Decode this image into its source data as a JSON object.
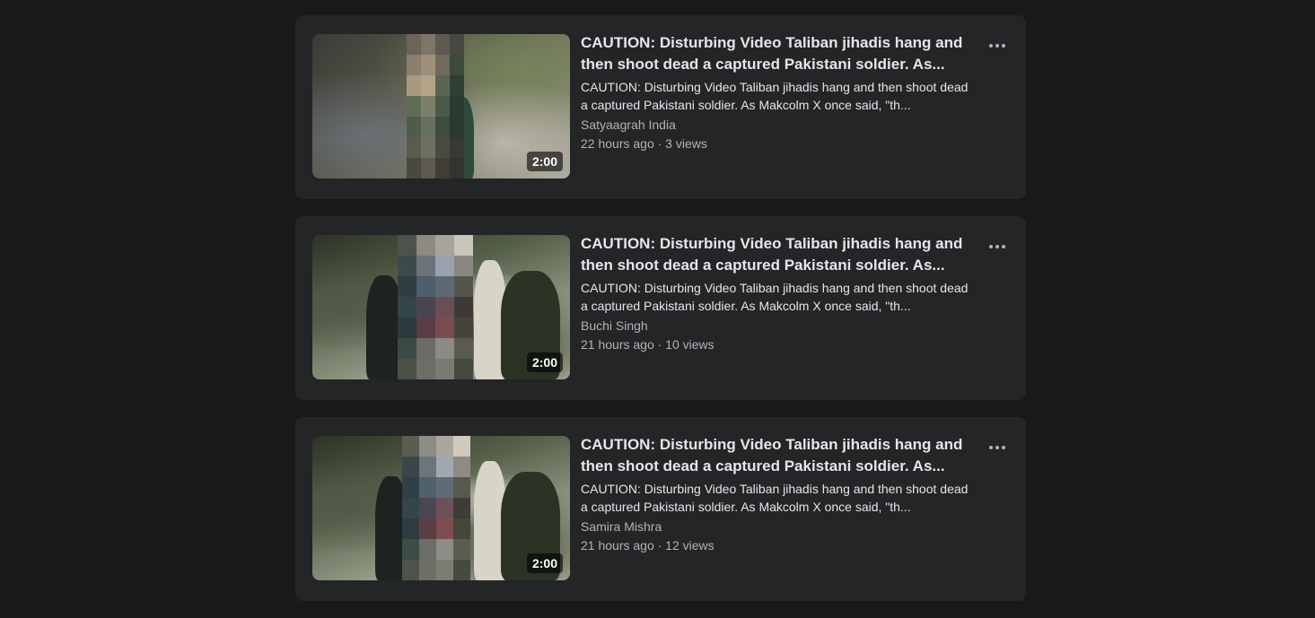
{
  "videos": [
    {
      "title": "CAUTION: Disturbing Video Taliban jihadis hang and then shoot dead a captured Pakistani soldier. As...",
      "description": "CAUTION: Disturbing Video Taliban jihadis hang and then shoot dead a captured Pakistani soldier. As Makcolm X once said, \"th...",
      "author": "Satyaagrah India",
      "meta": "22 hours ago · 3 views",
      "duration": "2:00",
      "more_icon": "more-options-icon"
    },
    {
      "title": "CAUTION: Disturbing Video Taliban jihadis hang and then shoot dead a captured Pakistani soldier. As...",
      "description": "CAUTION: Disturbing Video Taliban jihadis hang and then shoot dead a captured Pakistani soldier. As Makcolm X once said, \"th...",
      "author": "Buchi Singh",
      "meta": "21 hours ago · 10 views",
      "duration": "2:00",
      "more_icon": "more-options-icon"
    },
    {
      "title": "CAUTION: Disturbing Video Taliban jihadis hang and then shoot dead a captured Pakistani soldier. As...",
      "description": "CAUTION: Disturbing Video Taliban jihadis hang and then shoot dead a captured Pakistani soldier. As Makcolm X once said, \"th...",
      "author": "Samira Mishra",
      "meta": "21 hours ago · 12 views",
      "duration": "2:00",
      "more_icon": "more-options-icon"
    }
  ],
  "colors": {
    "page_background": "#18191a",
    "card_background": "#242526",
    "primary_text": "#e4e6eb",
    "secondary_text": "#b0b3b8"
  }
}
